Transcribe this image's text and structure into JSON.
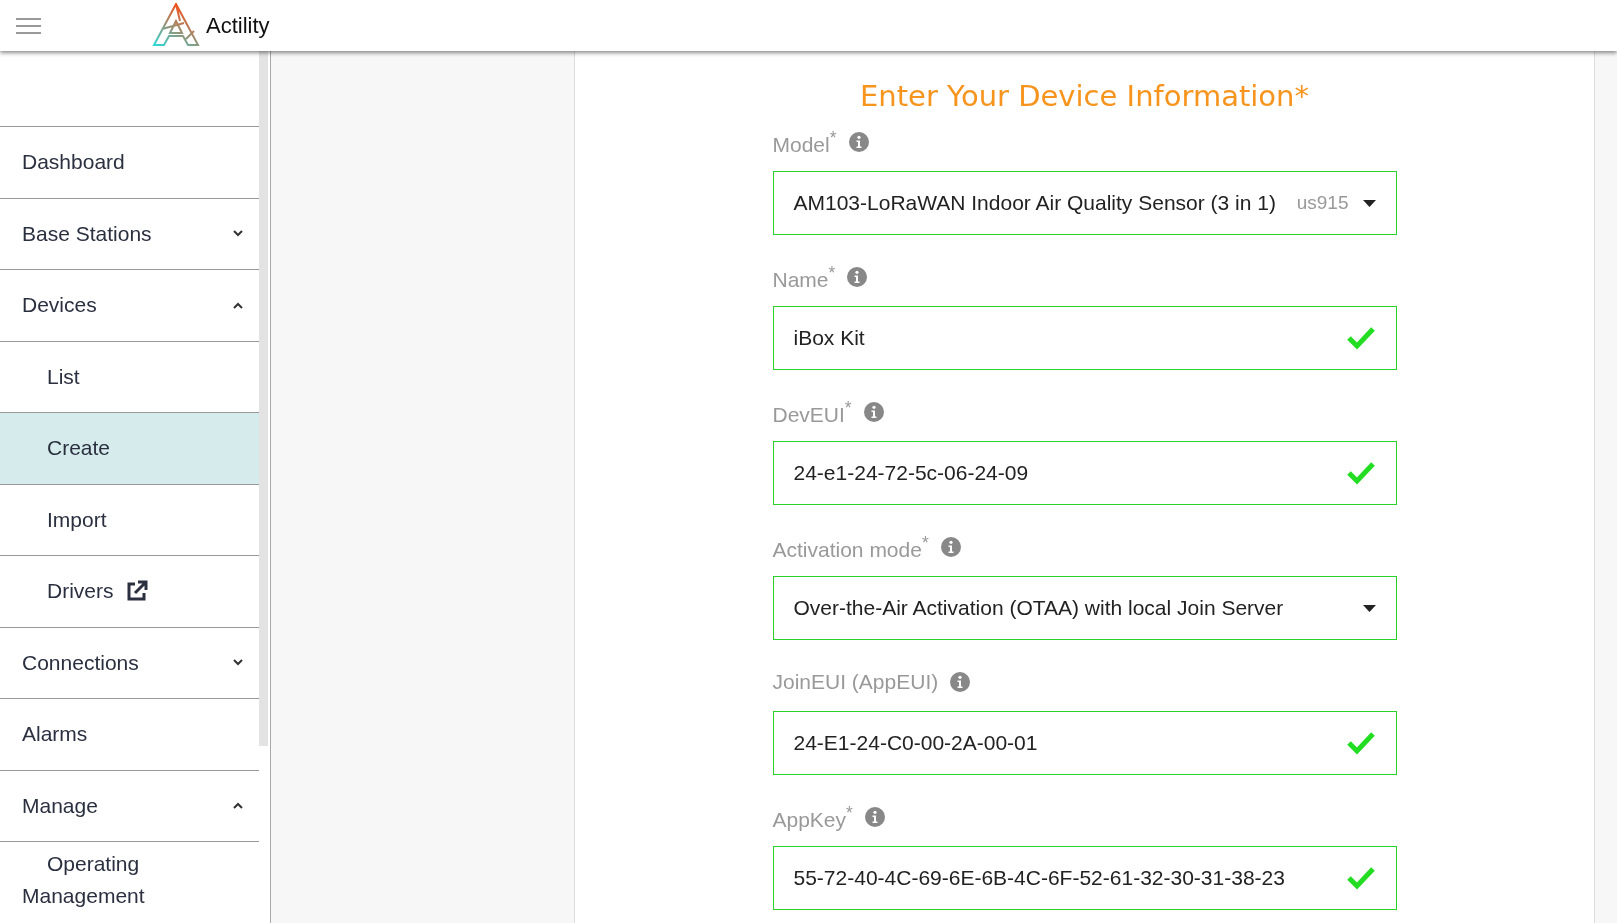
{
  "header": {
    "brand": "Actility"
  },
  "sidebar": {
    "items": [
      {
        "label": "Dashboard",
        "selected": false
      },
      {
        "label": "Base Stations",
        "expanded": false,
        "selected": false
      },
      {
        "label": "Devices",
        "expanded": true,
        "selected": false,
        "children": [
          {
            "label": "List",
            "selected": false
          },
          {
            "label": "Create",
            "selected": true
          },
          {
            "label": "Import",
            "selected": false
          },
          {
            "label": "Drivers",
            "selected": false,
            "external": true
          }
        ]
      },
      {
        "label": "Connections",
        "expanded": false,
        "selected": false
      },
      {
        "label": "Alarms",
        "selected": false
      },
      {
        "label": "Manage",
        "expanded": true,
        "selected": false,
        "children": [
          {
            "label": "Operating Management",
            "selected": false
          }
        ]
      }
    ]
  },
  "form": {
    "title": "Enter Your Device Information*",
    "fields": [
      {
        "kind": "select",
        "label": "Model$^{*}$",
        "value": "AM103-LoRaWAN Indoor Air Quality Sensor (3 in 1)",
        "hint": "us915",
        "valid": false
      },
      {
        "kind": "text",
        "label": "Name$^{*}$",
        "value": "iBox Kit",
        "valid": true
      },
      {
        "kind": "text",
        "label": "DevEUI$^{*}$",
        "value": "24-e1-24-72-5c-06-24-09",
        "valid": true
      },
      {
        "kind": "select",
        "label": "Activation mode$^{*}$",
        "value": "Over-the-Air Activation (OTAA) with local Join Server",
        "valid": false
      },
      {
        "kind": "text",
        "label": "JoinEUI (AppEUI)",
        "value": "24-E1-24-C0-00-2A-00-01",
        "valid": true
      },
      {
        "kind": "text",
        "label": "AppKey$^{*}$",
        "value": "55-72-40-4C-69-6E-6B-4C-6F-52-61-32-30-31-38-23",
        "valid": true
      }
    ]
  }
}
